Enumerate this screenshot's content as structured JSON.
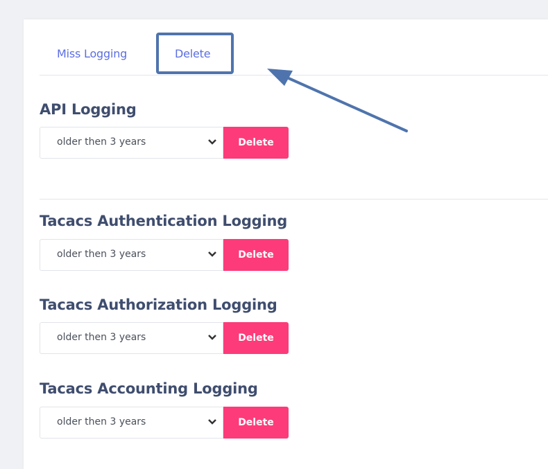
{
  "tabs": {
    "miss_logging": "Miss Logging",
    "delete": "Delete"
  },
  "sections": [
    {
      "title": "API Logging",
      "select_value": "older then 3 years",
      "button_label": "Delete"
    },
    {
      "title": "Tacacs Authentication Logging",
      "select_value": "older then 3 years",
      "button_label": "Delete"
    },
    {
      "title": "Tacacs Authorization Logging",
      "select_value": "older then 3 years",
      "button_label": "Delete"
    },
    {
      "title": "Tacacs Accounting Logging",
      "select_value": "older then 3 years",
      "button_label": "Delete"
    }
  ],
  "colors": {
    "tab_link": "#5b6ee1",
    "danger_button": "#fd3b7a",
    "annotation": "#4f74ad"
  }
}
